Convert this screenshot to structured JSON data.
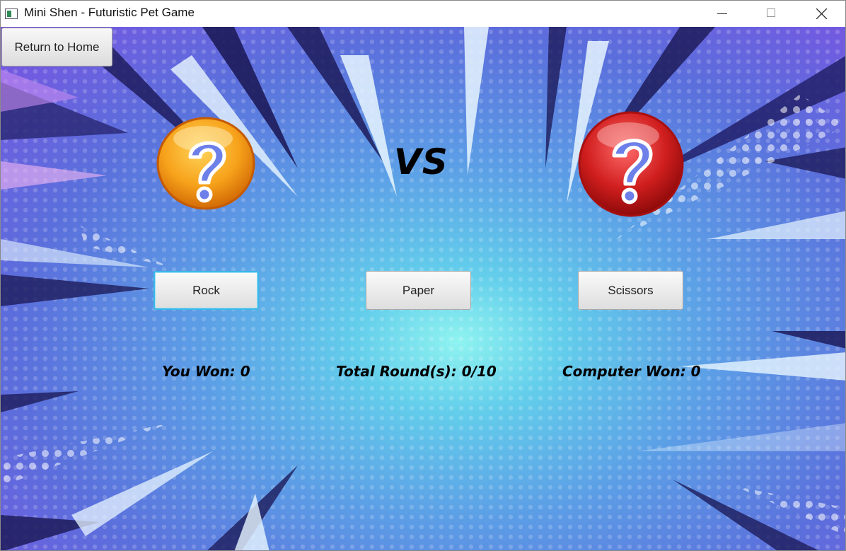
{
  "window": {
    "title": "Mini Shen - Futuristic Pet Game",
    "controls": [
      "minimize",
      "maximize",
      "close"
    ]
  },
  "nav": {
    "home_label": "Return to Home"
  },
  "players": {
    "player_icon": "question-mark-orange-icon",
    "computer_icon": "question-mark-red-icon",
    "vs_label": "VS"
  },
  "choices": [
    {
      "label": "Rock",
      "focused": true
    },
    {
      "label": "Paper",
      "focused": false
    },
    {
      "label": "Scissors",
      "focused": false
    }
  ],
  "score": {
    "you_won": "You Won: 0",
    "total_rounds": "Total Round(s): 0/10",
    "computer_won": "Computer Won: 0"
  },
  "colors": {
    "player_ball": "#f6a21a",
    "computer_ball": "#d01e1e",
    "focus_ring": "#3ab8e8",
    "bg_center": "#8ff3f0",
    "bg_edge": "#7a52e2"
  }
}
